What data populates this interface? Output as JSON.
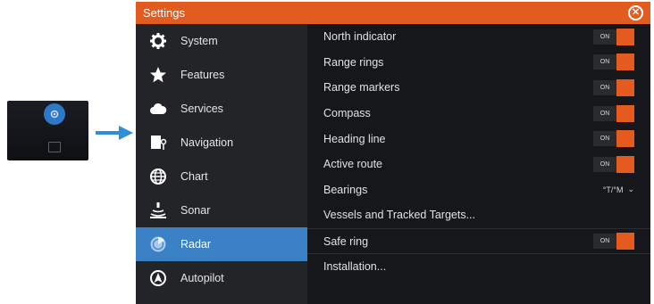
{
  "window": {
    "title": "Settings"
  },
  "sidebar": {
    "items": [
      {
        "label": "System",
        "icon": "gear-icon"
      },
      {
        "label": "Features",
        "icon": "star-icon"
      },
      {
        "label": "Services",
        "icon": "cloud-icon"
      },
      {
        "label": "Navigation",
        "icon": "navigation-icon"
      },
      {
        "label": "Chart",
        "icon": "globe-icon"
      },
      {
        "label": "Sonar",
        "icon": "sonar-icon"
      },
      {
        "label": "Radar",
        "icon": "radar-icon",
        "active": true
      },
      {
        "label": "Autopilot",
        "icon": "autopilot-icon"
      }
    ]
  },
  "settings": {
    "rows": [
      {
        "label": "North indicator",
        "control": "toggle",
        "value": "ON"
      },
      {
        "label": "Range rings",
        "control": "toggle",
        "value": "ON"
      },
      {
        "label": "Range markers",
        "control": "toggle",
        "value": "ON"
      },
      {
        "label": "Compass",
        "control": "toggle",
        "value": "ON"
      },
      {
        "label": "Heading line",
        "control": "toggle",
        "value": "ON"
      },
      {
        "label": "Active route",
        "control": "toggle",
        "value": "ON"
      },
      {
        "label": "Bearings",
        "control": "select",
        "value": "°T/°M"
      },
      {
        "label": "Vessels and Tracked Targets...",
        "control": "none"
      },
      {
        "label": "Safe ring",
        "control": "toggle",
        "value": "ON"
      },
      {
        "label": "Installation...",
        "control": "none"
      }
    ]
  },
  "colors": {
    "accent": "#e25b1f",
    "active": "#3a81c6",
    "arrow": "#2f8fd6"
  }
}
